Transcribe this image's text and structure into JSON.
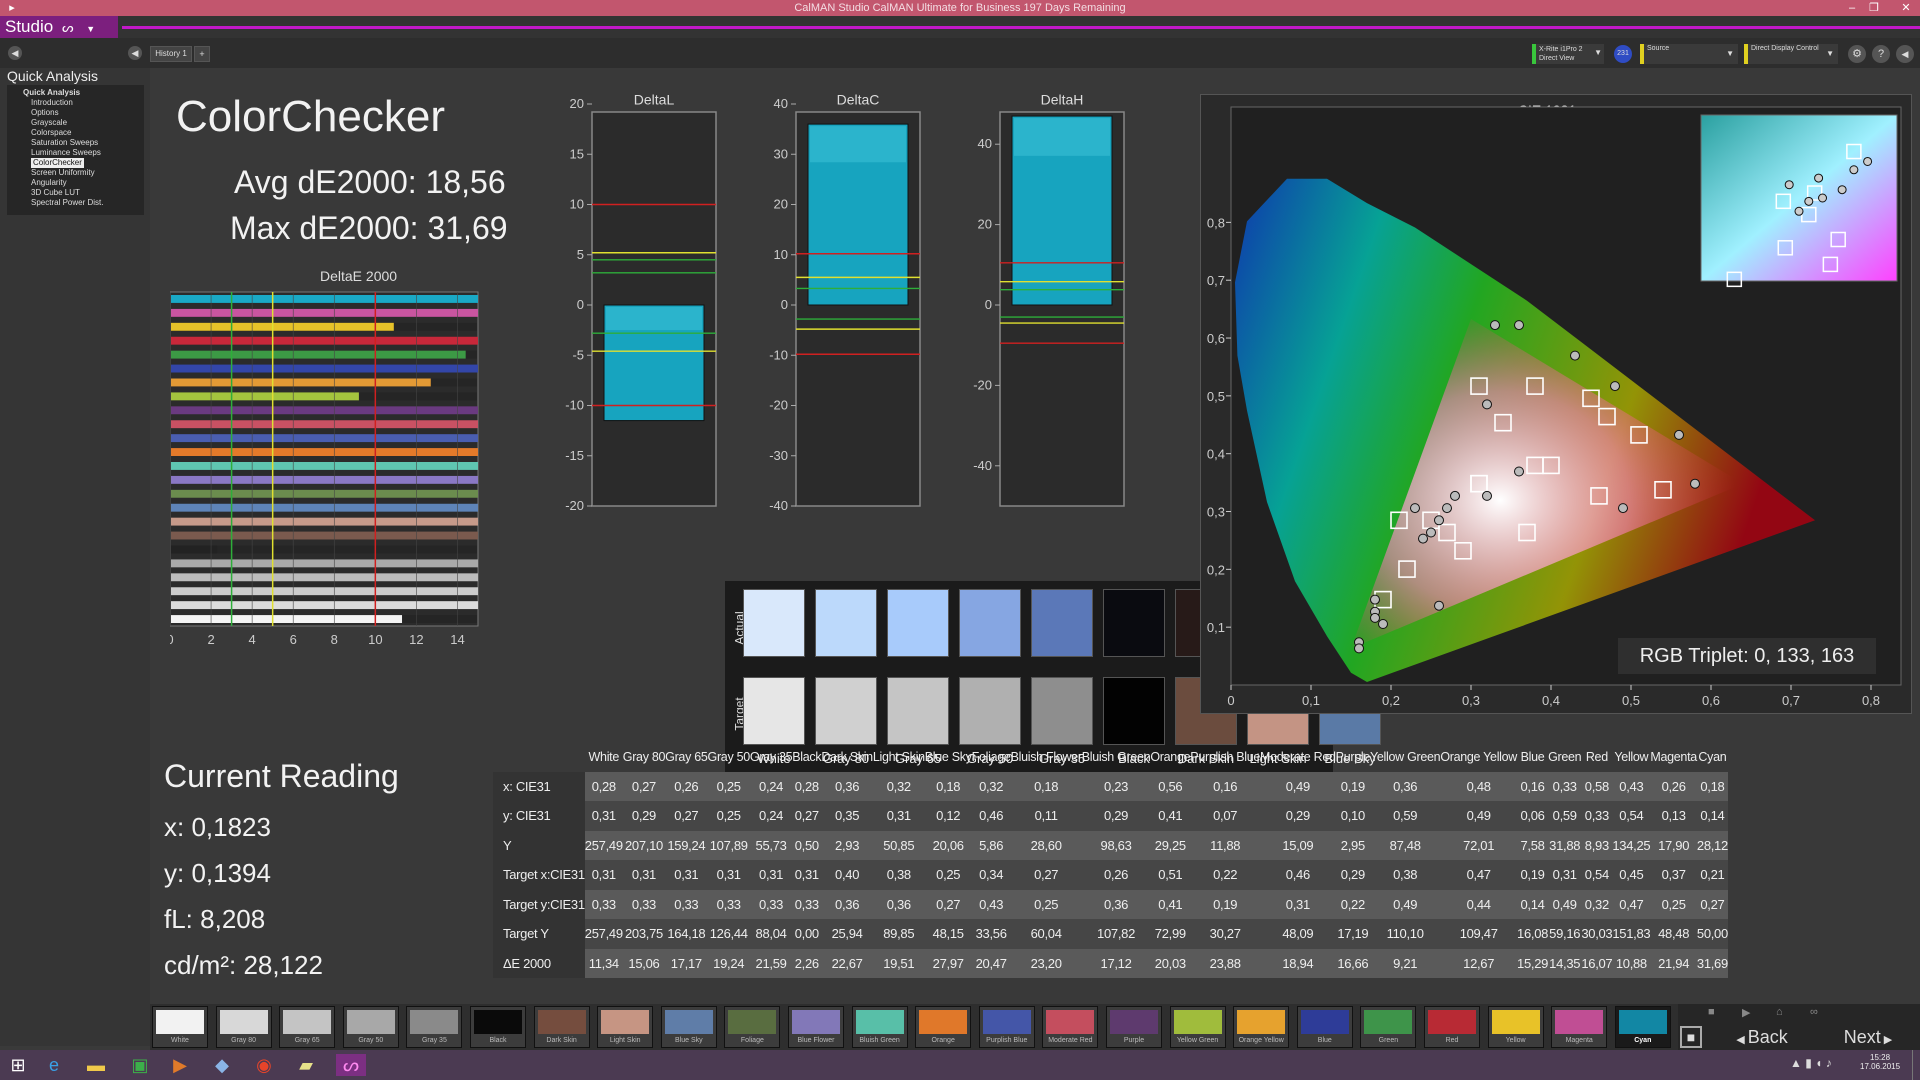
{
  "title_bar": {
    "text": "CalMAN Studio CalMAN Ultimate for Business 197 Days Remaining"
  },
  "app": {
    "brand": "Studio",
    "history_tab": "History 1",
    "add_tab": "+"
  },
  "toolbar": {
    "meter_line1": "X-Rite i1Pro 2",
    "meter_line2": "Direct View",
    "meter_badge": "231",
    "source": "Source",
    "display_control": "Direct Display Control"
  },
  "sidebar": {
    "title": "Quick Analysis",
    "items": [
      {
        "label": "Quick Analysis",
        "parent": true
      },
      {
        "label": "Introduction"
      },
      {
        "label": "Options"
      },
      {
        "label": "Grayscale"
      },
      {
        "label": "Colorspace"
      },
      {
        "label": "Saturation Sweeps"
      },
      {
        "label": "Luminance Sweeps"
      },
      {
        "label": "ColorChecker",
        "active": true
      },
      {
        "label": "Screen Uniformity"
      },
      {
        "label": "Angularity"
      },
      {
        "label": "3D Cube LUT"
      },
      {
        "label": "Spectral Power Dist."
      }
    ]
  },
  "main": {
    "title": "ColorChecker",
    "avg": "Avg dE2000: 18,56",
    "max": "Max dE2000: 31,69",
    "current_reading_title": "Current Reading",
    "reading_x": "x: 0,1823",
    "reading_y": "y: 0,1394",
    "reading_fl": "fL: 8,208",
    "reading_cd": "cd/m²: 28,122",
    "rgb_triplet": "RGB Triplet: 0, 133, 163"
  },
  "deltae_chart": {
    "title": "DeltaE 2000",
    "ticks": [
      "0",
      "2",
      "4",
      "6",
      "8",
      "10",
      "12",
      "14"
    ],
    "xlim": [
      0,
      15
    ],
    "threshold_lines": [
      {
        "value": 3,
        "color": "#2eae3a"
      },
      {
        "value": 5,
        "color": "#e0e030"
      },
      {
        "value": 10,
        "color": "#d02020"
      }
    ],
    "bars": [
      {
        "value": 15,
        "color": "#1aa9c6"
      },
      {
        "value": 15,
        "color": "#c955a0"
      },
      {
        "value": 10.9,
        "color": "#e6c229"
      },
      {
        "value": 15,
        "color": "#c7283a"
      },
      {
        "value": 14.4,
        "color": "#3c9a45"
      },
      {
        "value": 15,
        "color": "#3346a8"
      },
      {
        "value": 12.7,
        "color": "#e39a35"
      },
      {
        "value": 9.2,
        "color": "#a4c43e"
      },
      {
        "value": 15,
        "color": "#6a3a80"
      },
      {
        "value": 15,
        "color": "#c95163"
      },
      {
        "value": 15,
        "color": "#4a5eb0"
      },
      {
        "value": 15,
        "color": "#e47a2a"
      },
      {
        "value": 15,
        "color": "#5fc6b1"
      },
      {
        "value": 15,
        "color": "#8a78c4"
      },
      {
        "value": 15,
        "color": "#6b8c4e"
      },
      {
        "value": 15,
        "color": "#5e84b8"
      },
      {
        "value": 15,
        "color": "#c69a8a"
      },
      {
        "value": 15,
        "color": "#7a5a4e"
      },
      {
        "value": 2.3,
        "color": "#222222"
      },
      {
        "value": 15,
        "color": "#aaaaaa"
      },
      {
        "value": 15,
        "color": "#bcbcbc"
      },
      {
        "value": 15,
        "color": "#cccccc"
      },
      {
        "value": 15,
        "color": "#dcdcdc"
      },
      {
        "value": 11.3,
        "color": "#f4f4f4"
      }
    ]
  },
  "chart_data": [
    {
      "type": "bar",
      "title": "DeltaL",
      "ylim": [
        -20,
        20
      ],
      "ticks": [
        "20",
        "15",
        "10",
        "5",
        "0",
        "-5",
        "-10",
        "-15",
        "-20"
      ],
      "value": -11.5,
      "lines": [
        {
          "value": 10,
          "color": "#d02020"
        },
        {
          "value": 5.2,
          "color": "#e0e030"
        },
        {
          "value": 4.5,
          "color": "#2eae3a"
        },
        {
          "value": 3.2,
          "color": "#2eae3a"
        },
        {
          "value": -2.8,
          "color": "#2eae3a"
        },
        {
          "value": -4.6,
          "color": "#e0e030"
        },
        {
          "value": -10,
          "color": "#d02020"
        }
      ]
    },
    {
      "type": "bar",
      "title": "DeltaC",
      "ylim": [
        -40,
        40
      ],
      "ticks": [
        "40",
        "30",
        "20",
        "10",
        "0",
        "-10",
        "-20",
        "-30",
        "-40"
      ],
      "value": 36,
      "lines": [
        {
          "value": 10.2,
          "color": "#d02020"
        },
        {
          "value": 5.5,
          "color": "#e0e030"
        },
        {
          "value": 3.3,
          "color": "#2eae3a"
        },
        {
          "value": -2.8,
          "color": "#2eae3a"
        },
        {
          "value": -4.8,
          "color": "#e0e030"
        },
        {
          "value": -9.8,
          "color": "#d02020"
        }
      ]
    },
    {
      "type": "bar",
      "title": "DeltaH",
      "ylim": [
        -50,
        50
      ],
      "ticks": [
        "40",
        "20",
        "0",
        "-20",
        "-40"
      ],
      "tick_values": [
        40,
        20,
        0,
        -20,
        -40
      ],
      "value": 47,
      "lines": [
        {
          "value": 10.5,
          "color": "#d02020"
        },
        {
          "value": 5.8,
          "color": "#e0e030"
        },
        {
          "value": 3.8,
          "color": "#2eae3a"
        },
        {
          "value": -3.0,
          "color": "#2eae3a"
        },
        {
          "value": -4.5,
          "color": "#e0e030"
        },
        {
          "value": -9.5,
          "color": "#d02020"
        }
      ]
    },
    {
      "type": "scatter",
      "title": "CIE 1931 xy",
      "xlim": [
        0,
        0.82
      ],
      "ylim": [
        0,
        0.82
      ],
      "xticks": [
        "0",
        "0,1",
        "0,2",
        "0,3",
        "0,4",
        "0,5",
        "0,6",
        "0,7",
        "0,8"
      ],
      "yticks": [
        "0,1",
        "0,2",
        "0,3",
        "0,4",
        "0,5",
        "0,6",
        "0,7",
        "0,8"
      ],
      "gamut": [
        [
          0.64,
          0.33
        ],
        [
          0.3,
          0.6
        ],
        [
          0.15,
          0.06
        ]
      ],
      "targets": [
        [
          0.31,
          0.33
        ],
        [
          0.4,
          0.36
        ],
        [
          0.38,
          0.36
        ],
        [
          0.25,
          0.27
        ],
        [
          0.34,
          0.43
        ],
        [
          0.27,
          0.25
        ],
        [
          0.51,
          0.41
        ],
        [
          0.22,
          0.19
        ],
        [
          0.46,
          0.31
        ],
        [
          0.29,
          0.22
        ],
        [
          0.38,
          0.49
        ],
        [
          0.47,
          0.44
        ],
        [
          0.19,
          0.14
        ],
        [
          0.31,
          0.49
        ],
        [
          0.54,
          0.32
        ],
        [
          0.45,
          0.47
        ],
        [
          0.37,
          0.25
        ],
        [
          0.21,
          0.27
        ],
        [
          0.31,
          0.33
        ]
      ],
      "actuals": [
        [
          0.28,
          0.31
        ],
        [
          0.27,
          0.29
        ],
        [
          0.26,
          0.27
        ],
        [
          0.25,
          0.25
        ],
        [
          0.24,
          0.24
        ],
        [
          0.36,
          0.35
        ],
        [
          0.32,
          0.31
        ],
        [
          0.18,
          0.12
        ],
        [
          0.32,
          0.46
        ],
        [
          0.18,
          0.11
        ],
        [
          0.23,
          0.29
        ],
        [
          0.56,
          0.41
        ],
        [
          0.16,
          0.07
        ],
        [
          0.49,
          0.29
        ],
        [
          0.19,
          0.1
        ],
        [
          0.36,
          0.59
        ],
        [
          0.48,
          0.49
        ],
        [
          0.16,
          0.06
        ],
        [
          0.33,
          0.59
        ],
        [
          0.58,
          0.33
        ],
        [
          0.43,
          0.54
        ],
        [
          0.26,
          0.13
        ],
        [
          0.18,
          0.14
        ]
      ]
    }
  ],
  "swatches": [
    {
      "name": "White",
      "actual": "#d9e8fb",
      "target": "#e6e6e6"
    },
    {
      "name": "Gray 80",
      "actual": "#bcd9fb",
      "target": "#d0d0d0"
    },
    {
      "name": "Gray 65",
      "actual": "#a8cbfb",
      "target": "#c5c5c5"
    },
    {
      "name": "Gray 50",
      "actual": "#86a6e2",
      "target": "#b0b0b0"
    },
    {
      "name": "Gray 35",
      "actual": "#5b78b8",
      "target": "#8e8e8e"
    },
    {
      "name": "Black",
      "actual": "#0a0b10",
      "target": "#020202"
    },
    {
      "name": "Dark Skin",
      "actual": "#271a18",
      "target": "#6b4c3e"
    },
    {
      "name": "Light Skin",
      "actual": "#857680",
      "target": "#c49484"
    },
    {
      "name": "Blue Sky",
      "actual": "#2632c6",
      "target": "#5a7aa6"
    }
  ],
  "table": {
    "columns": [
      "",
      "White",
      "Gray 80",
      "Gray 65",
      "Gray 50",
      "Gray 35",
      "Black",
      "Dark Skin",
      "Light Skin",
      "Blue Sky",
      "Foliage",
      "Bluish Flower",
      "Bluish Green",
      "Orange",
      "Purplish Blue",
      "Moderate Red",
      "Purple",
      "Yellow Green",
      "Orange Yellow",
      "Blue",
      "Green",
      "Red",
      "Yellow",
      "Magenta",
      "Cyan"
    ],
    "rows": [
      [
        "x: CIE31",
        "0,28",
        "0,27",
        "0,26",
        "0,25",
        "0,24",
        "0,28",
        "0,36",
        "0,32",
        "0,18",
        "0,32",
        "0,18",
        "0,23",
        "0,56",
        "0,16",
        "0,49",
        "0,19",
        "0,36",
        "0,48",
        "0,16",
        "0,33",
        "0,58",
        "0,43",
        "0,26",
        "0,18"
      ],
      [
        "y: CIE31",
        "0,31",
        "0,29",
        "0,27",
        "0,25",
        "0,24",
        "0,27",
        "0,35",
        "0,31",
        "0,12",
        "0,46",
        "0,11",
        "0,29",
        "0,41",
        "0,07",
        "0,29",
        "0,10",
        "0,59",
        "0,49",
        "0,06",
        "0,59",
        "0,33",
        "0,54",
        "0,13",
        "0,14"
      ],
      [
        "Y",
        "257,49",
        "207,10",
        "159,24",
        "107,89",
        "55,73",
        "0,50",
        "2,93",
        "50,85",
        "20,06",
        "5,86",
        "28,60",
        "98,63",
        "29,25",
        "11,88",
        "15,09",
        "2,95",
        "87,48",
        "72,01",
        "7,58",
        "31,88",
        "8,93",
        "134,25",
        "17,90",
        "28,12"
      ],
      [
        "Target x:CIE31",
        "0,31",
        "0,31",
        "0,31",
        "0,31",
        "0,31",
        "0,31",
        "0,40",
        "0,38",
        "0,25",
        "0,34",
        "0,27",
        "0,26",
        "0,51",
        "0,22",
        "0,46",
        "0,29",
        "0,38",
        "0,47",
        "0,19",
        "0,31",
        "0,54",
        "0,45",
        "0,37",
        "0,21"
      ],
      [
        "Target y:CIE31",
        "0,33",
        "0,33",
        "0,33",
        "0,33",
        "0,33",
        "0,33",
        "0,36",
        "0,36",
        "0,27",
        "0,43",
        "0,25",
        "0,36",
        "0,41",
        "0,19",
        "0,31",
        "0,22",
        "0,49",
        "0,44",
        "0,14",
        "0,49",
        "0,32",
        "0,47",
        "0,25",
        "0,27"
      ],
      [
        "Target Y",
        "257,49",
        "203,75",
        "164,18",
        "126,44",
        "88,04",
        "0,00",
        "25,94",
        "89,85",
        "48,15",
        "33,56",
        "60,04",
        "107,82",
        "72,99",
        "30,27",
        "48,09",
        "17,19",
        "110,10",
        "109,47",
        "16,08",
        "59,16",
        "30,03",
        "151,83",
        "48,48",
        "50,00"
      ],
      [
        "ΔE 2000",
        "11,34",
        "15,06",
        "17,17",
        "19,24",
        "21,59",
        "2,26",
        "22,67",
        "19,51",
        "27,97",
        "20,47",
        "23,20",
        "17,12",
        "20,03",
        "23,88",
        "18,94",
        "16,66",
        "9,21",
        "12,67",
        "15,29",
        "14,35",
        "16,07",
        "10,88",
        "21,94",
        "31,69"
      ]
    ]
  },
  "bottom_swatches": [
    {
      "name": "White",
      "color": "#f2f2f2"
    },
    {
      "name": "Gray 80",
      "color": "#d8d8d8"
    },
    {
      "name": "Gray 65",
      "color": "#c4c4c4"
    },
    {
      "name": "Gray 50",
      "color": "#a8a8a8"
    },
    {
      "name": "Gray 35",
      "color": "#8a8a8a"
    },
    {
      "name": "Black",
      "color": "#0a0a0a"
    },
    {
      "name": "Dark Skin",
      "color": "#754d3e"
    },
    {
      "name": "Light Skin",
      "color": "#c69583"
    },
    {
      "name": "Blue Sky",
      "color": "#5f7da8"
    },
    {
      "name": "Foliage",
      "color": "#596d40"
    },
    {
      "name": "Blue Flower",
      "color": "#8278b8"
    },
    {
      "name": "Bluish Green",
      "color": "#58bfa8"
    },
    {
      "name": "Orange",
      "color": "#e0782a"
    },
    {
      "name": "Purplish Blue",
      "color": "#4456a8"
    },
    {
      "name": "Moderate Red",
      "color": "#c44e5e"
    },
    {
      "name": "Purple",
      "color": "#5e3a6e"
    },
    {
      "name": "Yellow Green",
      "color": "#a0bc3c"
    },
    {
      "name": "Orange Yellow",
      "color": "#e6a22e"
    },
    {
      "name": "Blue",
      "color": "#2e3c98"
    },
    {
      "name": "Green",
      "color": "#3e944a"
    },
    {
      "name": "Red",
      "color": "#b82a34"
    },
    {
      "name": "Yellow",
      "color": "#e8c228"
    },
    {
      "name": "Magenta",
      "color": "#c04e94"
    },
    {
      "name": "Cyan",
      "color": "#1287a4",
      "active": true
    }
  ],
  "nav": {
    "back": "Back",
    "next": "Next"
  },
  "clock": {
    "time": "15:28",
    "date": "17.06.2015"
  }
}
